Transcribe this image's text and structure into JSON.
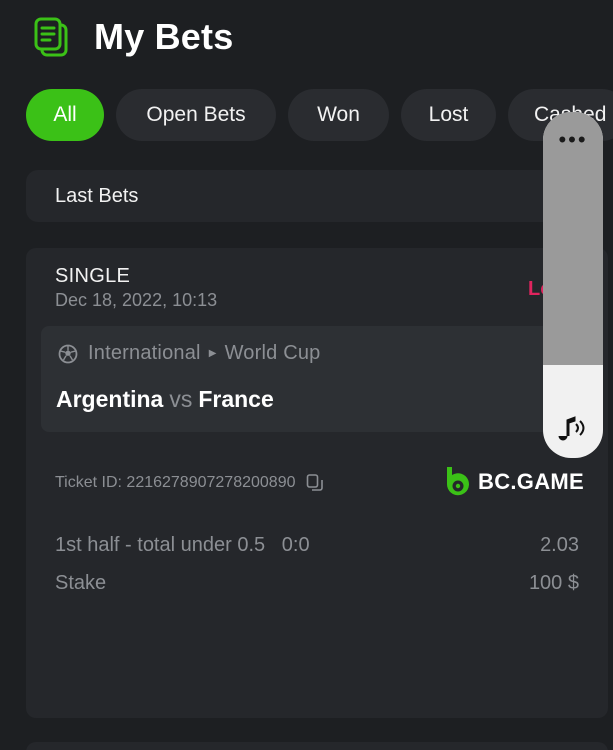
{
  "header": {
    "title": "My Bets",
    "icon": "document-list-icon",
    "accent": "#3bc117"
  },
  "tabs": [
    {
      "label": "All",
      "active": true
    },
    {
      "label": "Open Bets",
      "active": false
    },
    {
      "label": "Won",
      "active": false
    },
    {
      "label": "Lost",
      "active": false
    },
    {
      "label": "Cashed",
      "active": false
    }
  ],
  "section": {
    "label": "Last Bets"
  },
  "bet": {
    "type": "SINGLE",
    "date": "Dec 18, 2022, 10:13",
    "status": "Lost",
    "status_color": "#e0245e",
    "event": {
      "category": "International",
      "league": "World Cup",
      "home": "Argentina",
      "vs": "vs",
      "away": "France"
    },
    "ticket_id": "Ticket ID: 2216278907278200890",
    "brand": "BC.GAME",
    "selection": "1st half - total under 0.5   0:0",
    "odds": "2.03",
    "stake_label": "Stake",
    "stake_value": "100 $"
  },
  "overlay": {
    "menu_icon": "more-dots-icon",
    "sound_icon": "sound-icon"
  }
}
